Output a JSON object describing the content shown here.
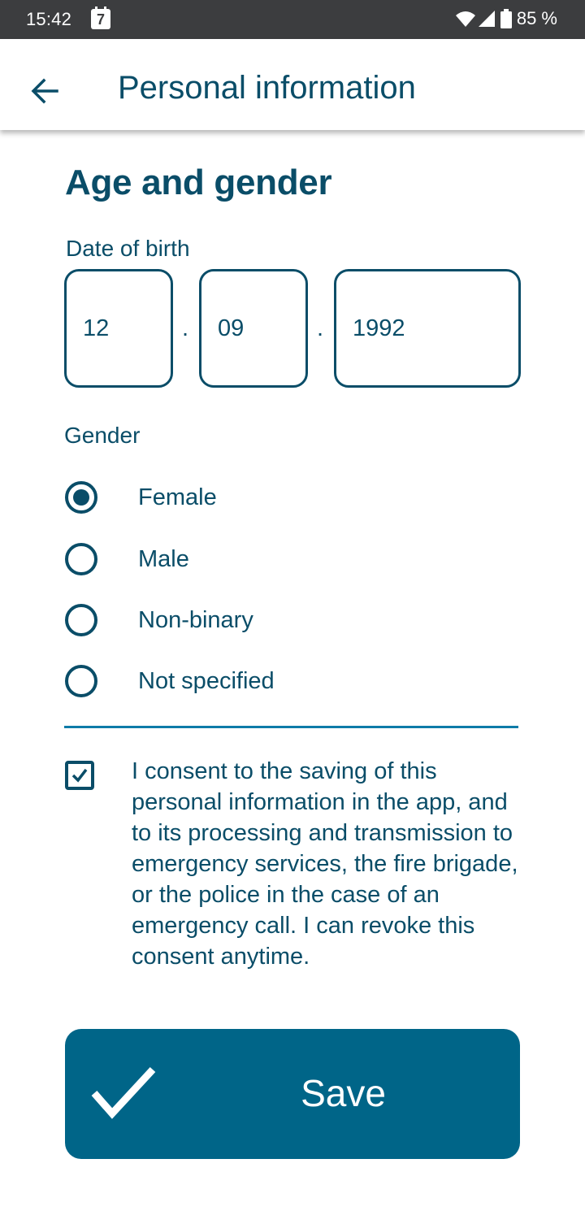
{
  "status_bar": {
    "time": "15:42",
    "calendar_day": "7",
    "battery_percent": "85 %",
    "icons": [
      "wifi-icon",
      "signal-icon",
      "battery-icon"
    ]
  },
  "app_bar": {
    "title": "Personal information",
    "back_icon": "arrow-left-icon"
  },
  "section": {
    "title": "Age and gender"
  },
  "date_of_birth": {
    "label": "Date of birth",
    "day": "12",
    "month": "09",
    "year": "1992",
    "separator": "."
  },
  "gender": {
    "label": "Gender",
    "options": [
      {
        "label": "Female",
        "selected": true
      },
      {
        "label": "Male",
        "selected": false
      },
      {
        "label": "Non-binary",
        "selected": false
      },
      {
        "label": "Not specified",
        "selected": false
      }
    ]
  },
  "consent": {
    "checked": true,
    "text": "I consent to the saving of this personal information in the app, and to its processing and transmission to emergency services, the fire brigade, or the police in the case of an emergency call. I can revoke this consent anytime."
  },
  "save_button": {
    "label": "Save",
    "icon": "checkmark-icon"
  },
  "colors": {
    "primary_text": "#0a4d68",
    "button_bg": "#006588",
    "divider": "#0e7ba8",
    "status_bar_bg": "#3c3d3f"
  }
}
